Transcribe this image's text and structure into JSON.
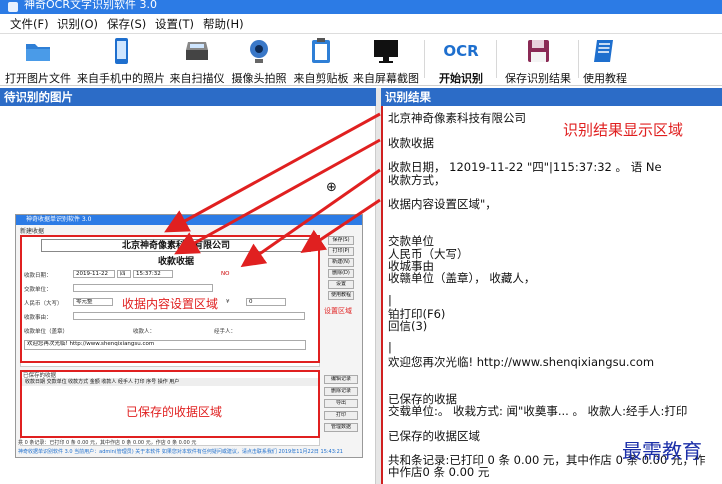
{
  "window": {
    "title": "神奇OCR文字识别软件 3.0"
  },
  "menu": [
    {
      "label": "文件(F)"
    },
    {
      "label": "识别(O)"
    },
    {
      "label": "保存(S)"
    },
    {
      "label": "设置(T)"
    },
    {
      "label": "帮助(H)"
    }
  ],
  "toolbar": {
    "open_image": "打开图片文件",
    "phone_photo": "来自手机中的照片",
    "scanner": "来自扫描仪",
    "camera": "摄像头拍照",
    "clipboard": "来自剪贴板",
    "screenshot": "来自屏幕截图",
    "ocr_icon_text": "OCR",
    "start_ocr": "开始识别",
    "save_result": "保存识别结果",
    "tutorial": "使用教程"
  },
  "left_panel": {
    "title": "待识别的图片"
  },
  "right_panel": {
    "title": "识别结果"
  },
  "preview": {
    "title_text": "神奇收据单识别软件 3.0",
    "new_receipt_label": "新建收据",
    "company": "北京神奇像素科技有限公司",
    "receipt_title": "收款收据",
    "date_label": "收款日期：",
    "date_value": "2019-11-22",
    "weekday_value": "四",
    "time_value": "15:37:32",
    "no_label": "NO",
    "payer_label": "交款单位：",
    "amount_label": "人民币（大写）",
    "amount_value": "零元整",
    "yuan_symbol": "¥",
    "amount_num": "0",
    "reason_label": "收款事由：",
    "unit_label": "收款单位（盖章）",
    "payee_label": "收款人：",
    "handler_label": "经手人：",
    "welcome_text": "欢迎您再次光临! http://www.shenqixiangsu.com",
    "side_buttons": [
      "保存(S)",
      "打印(P)",
      "新建(N)",
      "删除(D)",
      "设置",
      "使用教程"
    ],
    "side_area_label": "设置区域",
    "saved_head": "已保存的收据",
    "saved_columns": "收款日期  交款单位  收款方式  金额  收款人  经手人  打印  序号  操作  用户",
    "saved_buttons": [
      "编辑记录",
      "删除记录",
      "导出",
      "打印",
      "管理数据"
    ],
    "status_line1": "共 0 条记录：已打印 0 条 0.00 元，其中作店 0 条 0.00 元，作店 0 条 0.00 元",
    "status_line2": "神奇收据单识别软件 3.0  当前用户：admin(管理员)  关于本软件  如果您对本软件有任何疑问或建议，请点击联系我们  2019年11月22日 15:43:21",
    "annot_form": "收据内容设置区域",
    "annot_saved": "已保存的收据区域"
  },
  "results": {
    "lines": [
      "北京神奇像素科技有限公司",
      "收款收据",
      "收款日期，          12019-11-22 \"四\"|115:37:32 。 语                  Ne",
      "收款方式，",
      "收据内容设置区域\"，",
      "交款单位",
      "人民币（大写）",
      "收城事由",
      "收赣单位（盖章），              收藏人，",
      "|",
      "铂打印(F6)",
      "回信(3)",
      "|",
      "欢迎您再次光临! http://www.shenqixiangsu.com",
      "已保存的收据",
      "交载单位:。 收栽方式:    闻\"收奠事...  。 收款人:经手人:打印",
      "已保存的收据区域",
      "共和条记录:已打印 0 条 0.00 元，其中作店 0 条 0.00 元，作",
      "中作店0 条 0.00 元"
    ],
    "annotation": "识别结果显示区域"
  },
  "watermark": "最需教育",
  "colors": {
    "accent": "#2c7be5",
    "panel_head": "#2c6cc7",
    "annotation_red": "#e02020",
    "watermark": "#1b2fa8"
  }
}
